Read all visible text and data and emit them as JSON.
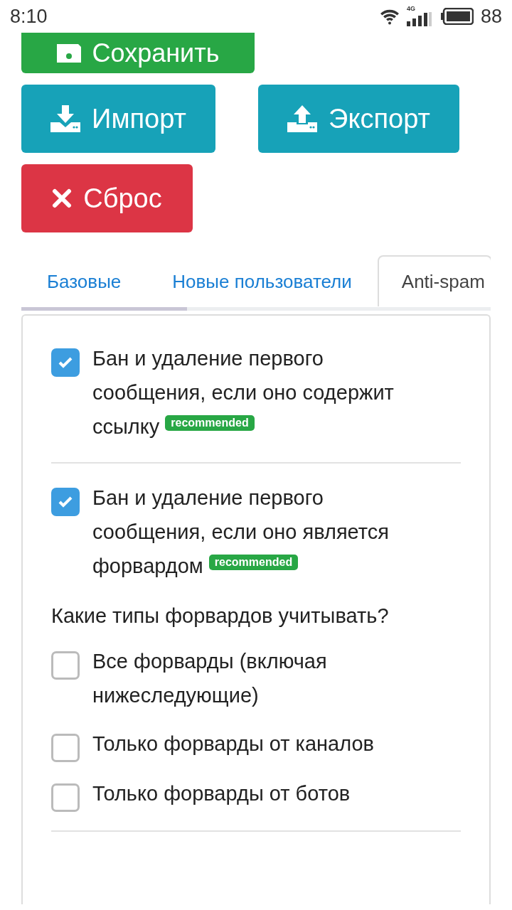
{
  "status_bar": {
    "time": "8:10",
    "network": "4G",
    "battery": "88"
  },
  "actions": [
    {
      "kind": "save",
      "label": "Сохранить"
    },
    {
      "kind": "import",
      "label": "Импорт"
    },
    {
      "kind": "export",
      "label": "Экспорт"
    },
    {
      "kind": "reset",
      "label": "Сброс"
    }
  ],
  "tabs": [
    {
      "label": "Базовые",
      "selected": false
    },
    {
      "label": "Новые пользователи",
      "selected": false
    },
    {
      "label": "Anti-spam",
      "selected": true
    }
  ],
  "panel": [
    {
      "kind": "checkbox",
      "label": "Бан и удаление первого сообщения, если оно содержит ссылку",
      "checked": true,
      "badge": "recommended"
    },
    {
      "kind": "divider"
    },
    {
      "kind": "checkbox",
      "label": "Бан и удаление первого сообщения, если оно является форвардом",
      "checked": true,
      "badge": "recommended"
    },
    {
      "kind": "question",
      "label": "Какие типы форвардов учитывать?"
    },
    {
      "kind": "checkbox",
      "label": "Все форварды (включая нижеследующие)",
      "checked": false
    },
    {
      "kind": "checkbox",
      "label": "Только форварды от каналов",
      "checked": false
    },
    {
      "kind": "checkbox",
      "label": "Только форварды от ботов",
      "checked": false
    },
    {
      "kind": "divider"
    }
  ]
}
